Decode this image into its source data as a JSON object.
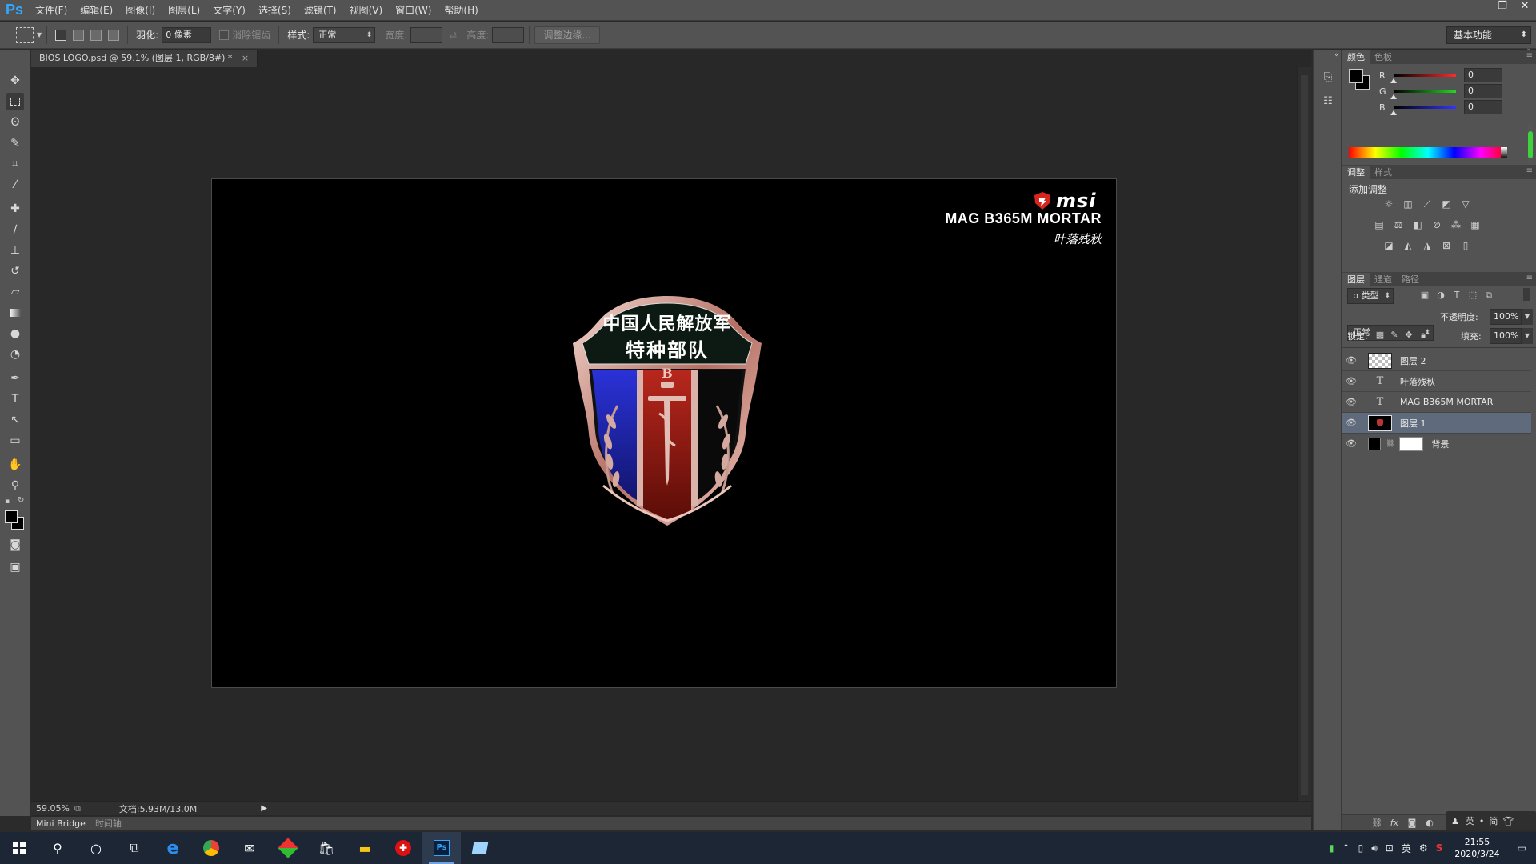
{
  "app": {
    "logo": "Ps",
    "brand_color": "#31a8ff"
  },
  "menu": [
    "文件(F)",
    "编辑(E)",
    "图像(I)",
    "图层(L)",
    "文字(Y)",
    "选择(S)",
    "滤镜(T)",
    "视图(V)",
    "窗口(W)",
    "帮助(H)"
  ],
  "window_controls": {
    "minimize": "—",
    "restore": "❐",
    "close": "✕"
  },
  "options": {
    "feather_label": "羽化:",
    "feather_value": "0 像素",
    "antialias_label": "消除锯齿",
    "style_label": "样式:",
    "style_value": "正常",
    "width_label": "宽度:",
    "height_label": "高度:",
    "refine_edge": "调整边缘...",
    "workspace": "基本功能"
  },
  "document": {
    "tab_title": "BIOS LOGO.psd @ 59.1% (图层 1, RGB/8#) *",
    "tab_close": "×",
    "canvas_text": {
      "brand": "msi",
      "model": "MAG B365M MORTAR",
      "signature": "叶落残秋"
    },
    "badge": {
      "line1": "中国人民解放军",
      "line2": "特种部队",
      "letter": "B"
    }
  },
  "status": {
    "zoom": "59.05%",
    "doc_info": "文档:5.93M/13.0M"
  },
  "bottom_tabs": [
    "Mini Bridge",
    "时间轴"
  ],
  "color_panel": {
    "tabs": [
      "颜色",
      "色板"
    ],
    "channels": [
      {
        "label": "R",
        "value": "0",
        "color": "#ff2a2a"
      },
      {
        "label": "G",
        "value": "0",
        "color": "#23d823"
      },
      {
        "label": "B",
        "value": "0",
        "color": "#3434ff"
      }
    ]
  },
  "adjust_panel": {
    "tabs": [
      "调整",
      "样式"
    ],
    "title": "添加调整"
  },
  "layers_panel": {
    "tabs": [
      "图层",
      "通道",
      "路径"
    ],
    "filter_label": "ρ 类型",
    "blend_mode": "正常",
    "opacity_label": "不透明度:",
    "opacity_value": "100%",
    "lock_label": "锁定:",
    "fill_label": "填充:",
    "fill_value": "100%",
    "layers": [
      {
        "name": "图层 2",
        "kind": "pixel-transparent",
        "selected": false
      },
      {
        "name": "叶落残秋",
        "kind": "text",
        "selected": false
      },
      {
        "name": "MAG B365M MORTAR",
        "kind": "text",
        "selected": false
      },
      {
        "name": "图层 1",
        "kind": "pixel-image",
        "selected": true
      },
      {
        "name": "背景",
        "kind": "background",
        "selected": false
      }
    ]
  },
  "ime": {
    "lang": "英",
    "mode": "简"
  },
  "taskbar": {
    "clock_time": "21:55",
    "clock_date": "2020/3/24",
    "ime_lang": "英"
  }
}
